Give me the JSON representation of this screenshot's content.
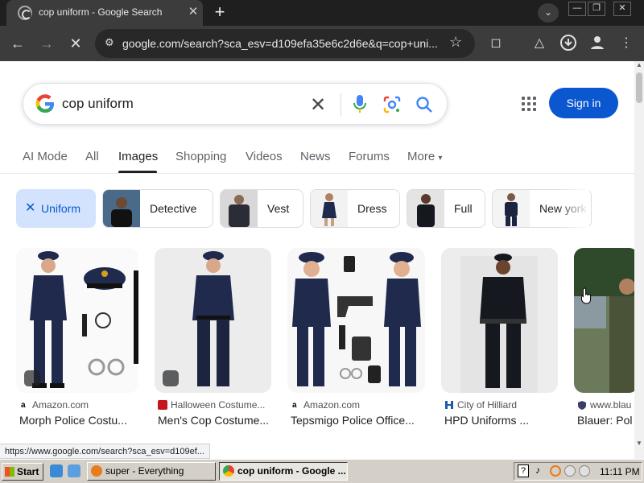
{
  "browser": {
    "tab_title": "cop uniform - Google Search",
    "tab_close": "✕",
    "new_tab": "+",
    "url": "google.com/search?sca_esv=d109efa35e6c2d6e&q=cop+uni..."
  },
  "search": {
    "query": "cop uniform",
    "signin_label": "Sign in"
  },
  "tabs": [
    {
      "label": "AI Mode"
    },
    {
      "label": "All"
    },
    {
      "label": "Images"
    },
    {
      "label": "Shopping"
    },
    {
      "label": "Videos"
    },
    {
      "label": "News"
    },
    {
      "label": "Forums"
    },
    {
      "label": "More"
    }
  ],
  "active_tab": "Images",
  "chips": [
    {
      "label": "Uniform",
      "selected": true
    },
    {
      "label": "Detective"
    },
    {
      "label": "Vest"
    },
    {
      "label": "Dress"
    },
    {
      "label": "Full"
    },
    {
      "label": "New york"
    }
  ],
  "results": [
    {
      "source": "Amazon.com",
      "title": "Morph Police Costu...",
      "icon": "amazon-icon"
    },
    {
      "source": "Halloween Costume...",
      "title": "Men's Cop Costume...",
      "icon": "halloween-costumes-icon"
    },
    {
      "source": "Amazon.com",
      "title": "Tepsmigo Police Office...",
      "icon": "amazon-icon"
    },
    {
      "source": "City of Hilliard",
      "title": "HPD Uniforms ...",
      "icon": "hilliard-icon"
    },
    {
      "source": "www.blau",
      "title": "Blauer: Pol",
      "icon": "blauer-icon"
    }
  ],
  "status_url": "https://www.google.com/search?sca_esv=d109ef...",
  "taskbar": {
    "start_label": "Start",
    "tasks": [
      {
        "label": "super - Everything"
      },
      {
        "label": "cop uniform - Google ..."
      }
    ],
    "clock": "11:11 PM"
  },
  "colors": {
    "accent_blue": "#0b57d0",
    "chip_selected": "#d3e3fd",
    "uniform_navy": "#1f2a4d"
  }
}
